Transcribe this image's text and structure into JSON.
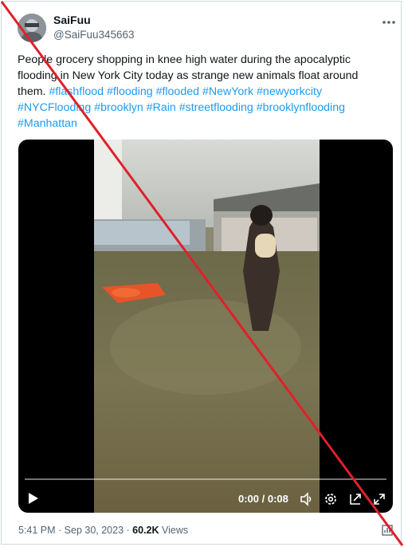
{
  "user": {
    "display_name": "SaiFuu",
    "handle": "@SaiFuu345663"
  },
  "tweet": {
    "text_plain_1": "People grocery shopping in knee high water during the apocalyptic flooding in New York City today as strange new animals float around them.",
    "hashtags": [
      "#flashflood",
      "#flooding",
      "#flooded",
      "#NewYork",
      "#newyorkcity",
      "#NYCFlooding",
      "#brooklyn",
      "#Rain",
      "#streetflooding",
      "#brooklynflooding",
      "#Manhattan"
    ]
  },
  "video": {
    "time_display": "0:00 / 0:08",
    "controls": [
      "play-icon",
      "volume-icon",
      "settings-icon",
      "pip-icon",
      "fullscreen-icon"
    ]
  },
  "meta": {
    "timestamp": "5:41 PM · Sep 30, 2023 · ",
    "views_count": "60.2K",
    "views_label": " Views"
  },
  "colors": {
    "link": "#1d9bf0",
    "cross": "#e0202a"
  }
}
